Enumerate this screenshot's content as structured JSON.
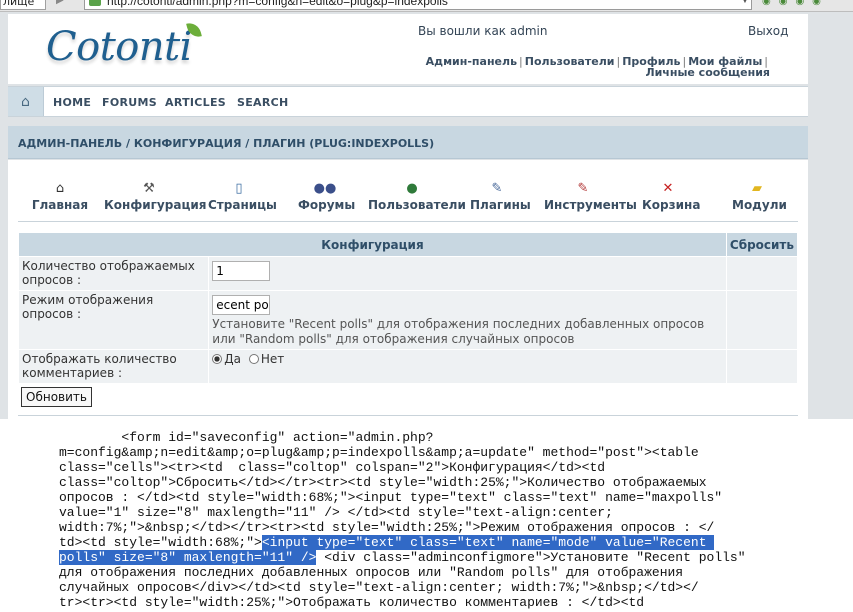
{
  "browser": {
    "left_cut_text": "лище",
    "url": "http://cotonti/admin.php?m=config&n=edit&o=plug&p=indexpolls"
  },
  "header": {
    "logo": "Cotonti",
    "welcome": "Вы вошли как admin",
    "logout": "Выход",
    "user_links": [
      "Админ-панель",
      "Пользователи",
      "Профиль",
      "Мои файлы",
      "Личные сообщения"
    ]
  },
  "nav": {
    "items": [
      "HOME",
      "FORUMS",
      "ARTICLES",
      "SEARCH"
    ]
  },
  "breadcrumb": "АДМИН-ПАНЕЛЬ / КОНФИГУРАЦИЯ / ПЛАГИН (PLUG:INDEXPOLLS)",
  "toolbar": [
    {
      "label": "Главная",
      "icon": "home-icon"
    },
    {
      "label": "Конфигурация",
      "icon": "hammer-icon"
    },
    {
      "label": "Страницы",
      "icon": "page-icon"
    },
    {
      "label": "Форумы",
      "icon": "forums-icon"
    },
    {
      "label": "Пользователи",
      "icon": "users-icon"
    },
    {
      "label": "Плагины",
      "icon": "plugins-icon"
    },
    {
      "label": "Инструменты",
      "icon": "tools-icon"
    },
    {
      "label": "Корзина",
      "icon": "trash-icon"
    },
    {
      "label": "Модули",
      "icon": "folder-icon"
    }
  ],
  "config_table": {
    "header_config": "Конфигурация",
    "header_reset": "Сбросить",
    "rows": [
      {
        "label": "Количество отображаемых опросов :",
        "value": "1"
      },
      {
        "label": "Режим отображения опросов :",
        "value": "ecent poll",
        "description": "Установите \"Recent polls\" для отображения последних добавленных опросов или \"Random polls\" для отображения случайных опросов"
      },
      {
        "label": "Отображать количество комментариев :",
        "radio_yes": "Да",
        "radio_no": "Нет"
      }
    ],
    "update_button": "Обновить"
  },
  "source_code": {
    "line1": "        <form id=\"saveconfig\" action=\"admin.php?",
    "line2": "m=config&amp;n=edit&amp;o=plug&amp;p=indexpolls&amp;a=update\" method=\"post\"><table",
    "line3": "class=\"cells\"><tr><td  class=\"coltop\" colspan=\"2\">Конфигурация</td><td",
    "line4": "class=\"coltop\">Сбросить</td></tr><tr><td style=\"width:25%;\">Количество отображаемых",
    "line5": "опросов : </td><td style=\"width:68%;\"><input type=\"text\" class=\"text\" name=\"maxpolls\"",
    "line6": "value=\"1\" size=\"8\" maxlength=\"11\" /> </td><td style=\"text-align:center;",
    "line7": "width:7%;\">&nbsp;</td></tr><tr><td style=\"width:25%;\">Режим отображения опросов : </",
    "line8a": "td><td style=\"width:68%;\">",
    "line8b": "<input type=\"text\" class=\"text\" name=\"mode\" value=\"Recent ",
    "line9a": "polls\" size=\"8\" maxlength=\"11\" />",
    "line9b": " <div class=\"adminconfigmore\">Установите \"Recent polls\"",
    "line10": "для отображения последних добавленных опросов или \"Random polls\" для отображения",
    "line11": "случайных опросов</div></td><td style=\"text-align:center; width:7%;\">&nbsp;</td></",
    "line12": "tr><tr><td style=\"width:25%;\">Отображать количество комментариев : </td><td"
  }
}
